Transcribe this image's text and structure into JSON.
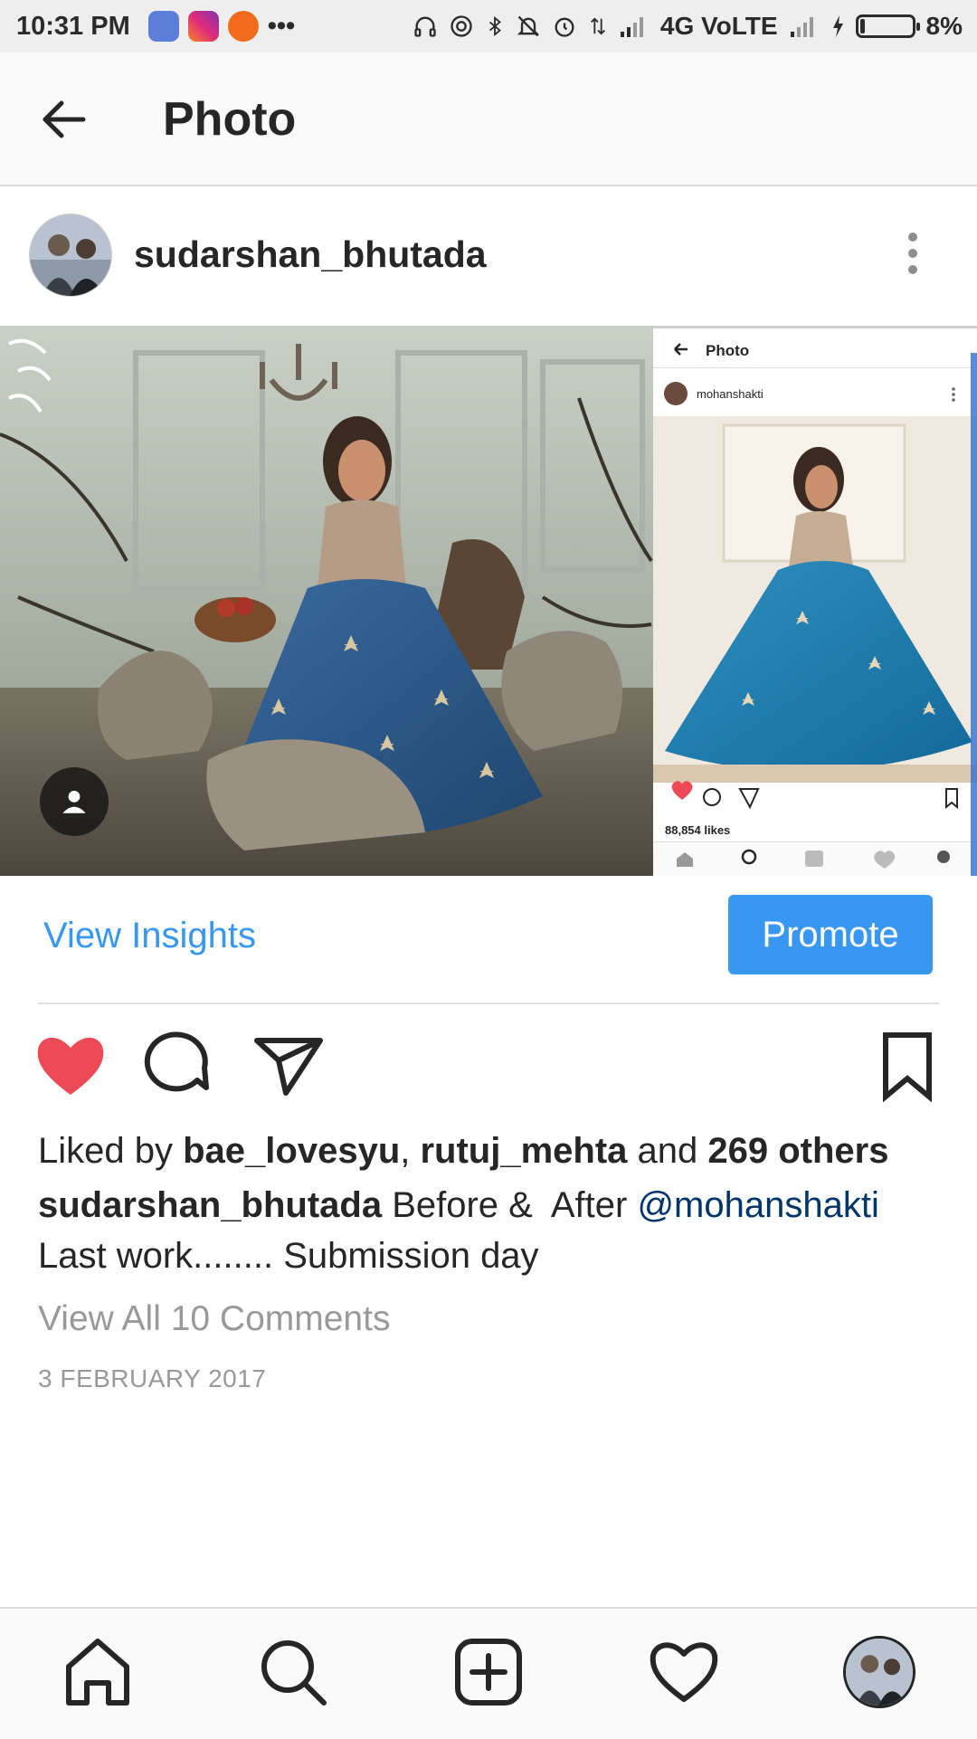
{
  "status_bar": {
    "time": "10:31 PM",
    "network": "4G VoLTE",
    "battery": "8%"
  },
  "app_bar": {
    "title": "Photo"
  },
  "post": {
    "username": "sudarshan_bhutada",
    "image_inset": {
      "title": "Photo",
      "username": "mohanshakti",
      "likes": "88,854 likes"
    },
    "insights_label": "View Insights",
    "promote_label": "Promote",
    "likes": {
      "prefix": "Liked by ",
      "user1": "bae_lovesyu",
      "sep": ", ",
      "user2": "rutuj_mehta",
      "and": " and ",
      "others": "269 others"
    },
    "caption": {
      "username": "sudarshan_bhutada",
      "text": " Before &  After ",
      "mention": "@mohanshakti",
      "line2": "Last work........ Submission day"
    },
    "view_comments": "View All 10 Comments",
    "date": "3 FEBRUARY 2017"
  },
  "colors": {
    "accent": "#3897f0",
    "like_red": "#ed4956",
    "mention": "#003569",
    "muted": "#999999"
  },
  "icons": [
    "back-arrow-icon",
    "kebab-menu-icon",
    "heart-icon",
    "comment-icon",
    "share-icon",
    "bookmark-icon",
    "home-icon",
    "search-icon",
    "add-icon",
    "activity-icon",
    "profile-avatar"
  ]
}
